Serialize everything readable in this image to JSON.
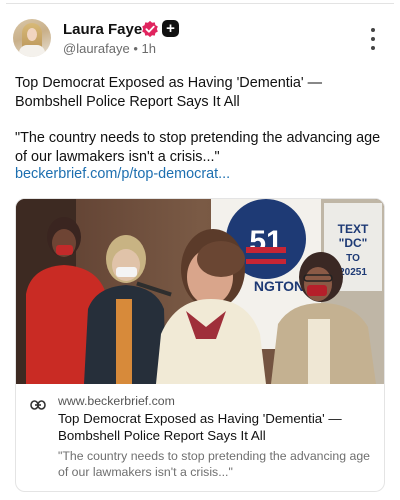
{
  "author": {
    "display_name": "Laura Faye",
    "handle": "@laurafaye",
    "separator": "•",
    "time": "1h",
    "plus_badge": "+",
    "verified_color": "#e0245e"
  },
  "post": {
    "headline": "Top Democrat Exposed as Having 'Dementia' — Bombshell Police Report Says It All",
    "quote": "\"The country needs to stop pretending the advancing age of our lawmakers isn't a crisis...\"",
    "link_text": "beckerbrief.com/p/top-democrat..."
  },
  "link_card": {
    "domain": "www.beckerbrief.com",
    "title": "Top Democrat Exposed as Having 'Dementia' — Bombshell Police Report Says It All",
    "description": "\"The country needs to stop pretending the advancing age of our lawmakers isn't a crisis...\"",
    "image": {
      "poster_number": "51",
      "poster_partial_text": "NGTON",
      "sign_lines": [
        "TEXT",
        "\"DC\"",
        "TO",
        "20251"
      ]
    }
  },
  "colors": {
    "link": "#1d6fb0",
    "text_primary": "#111111",
    "text_secondary": "#6b6b6b",
    "card_border": "#e4e4e4"
  },
  "icons": {
    "menu": "more-vertical-icon",
    "link": "link-icon",
    "verified": "verified-badge-icon"
  }
}
